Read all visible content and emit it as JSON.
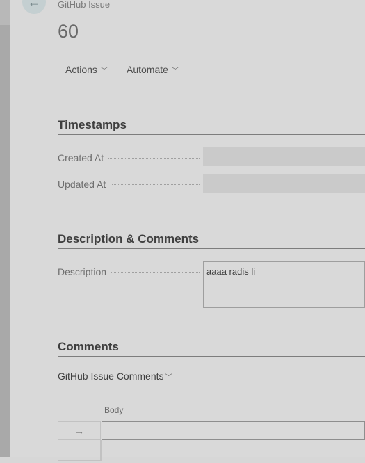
{
  "header": {
    "entity_type": "GitHub Issue",
    "title": "60"
  },
  "actions": {
    "actions_label": "Actions",
    "automate_label": "Automate"
  },
  "timestamps": {
    "section_title": "Timestamps",
    "created_at_label": "Created At",
    "created_at_value": "",
    "updated_at_label": "Updated At",
    "updated_at_value": ""
  },
  "description_section": {
    "section_title": "Description & Comments",
    "description_label": "Description",
    "description_value": "aaaa radis li"
  },
  "comments": {
    "section_title": "Comments",
    "subpage_title": "GitHub Issue Comments",
    "column_body": "Body",
    "rows": [
      {
        "body": ""
      }
    ]
  },
  "colors": {
    "background": "#d9d9d9",
    "back_button": "#c4cfd1",
    "field_background": "#cacaca"
  }
}
